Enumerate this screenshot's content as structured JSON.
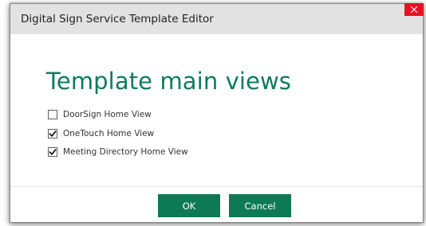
{
  "window": {
    "title": "Digital Sign Service Template Editor",
    "close_icon": "close-icon"
  },
  "main": {
    "heading": "Template main views",
    "options": [
      {
        "label": "DoorSign Home View",
        "checked": false
      },
      {
        "label": "OneTouch Home View",
        "checked": true
      },
      {
        "label": "Meeting Directory Home View",
        "checked": true
      }
    ]
  },
  "footer": {
    "ok_label": "OK",
    "cancel_label": "Cancel"
  },
  "colors": {
    "heading": "#0a7c5e",
    "button": "#0e7a55",
    "close": "#e81123",
    "titlebar": "#e2e2e2"
  }
}
